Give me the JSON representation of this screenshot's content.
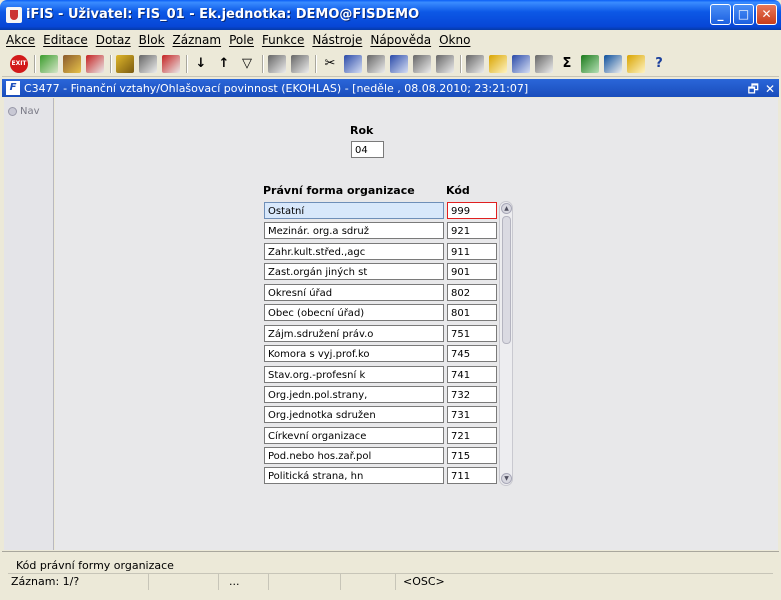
{
  "window": {
    "title": "iFIS - Uživatel: FIS_01 - Ek.jednotka: DEMO@FISDEMO"
  },
  "menu": [
    "Akce",
    "Editace",
    "Dotaz",
    "Blok",
    "Záznam",
    "Pole",
    "Funkce",
    "Nástroje",
    "Nápověda",
    "Okno"
  ],
  "toolbar": {
    "exit_label": "EXIT"
  },
  "form": {
    "title": "C3477 - Finanční vztahy/Ohlašovací povinnost (EKOHLAS) - [neděle , 08.08.2010; 23:21:07]",
    "nav_label": "Nav",
    "rok_label": "Rok",
    "rok_value": "04",
    "col_name_header": "Právní forma organizace",
    "col_code_header": "Kód",
    "rows": [
      {
        "name": "Ostatní",
        "code": "999"
      },
      {
        "name": "Mezinár. org.a sdruž",
        "code": "921"
      },
      {
        "name": "Zahr.kult.střed.,agc",
        "code": "911"
      },
      {
        "name": "Zast.orgán jiných st",
        "code": "901"
      },
      {
        "name": "Okresní úřad",
        "code": "802"
      },
      {
        "name": "Obec (obecní úřad)",
        "code": "801"
      },
      {
        "name": "Zájm.sdružení práv.o",
        "code": "751"
      },
      {
        "name": "Komora s vyj.prof.ko",
        "code": "745"
      },
      {
        "name": "Stav.org.-profesní k",
        "code": "741"
      },
      {
        "name": "Org.jedn.pol.strany,",
        "code": "732"
      },
      {
        "name": "Org.jednotka sdružen",
        "code": "731"
      },
      {
        "name": "Církevní organizace",
        "code": "721"
      },
      {
        "name": "Pod.nebo hos.zař.pol",
        "code": "715"
      },
      {
        "name": "Politická strana, hn",
        "code": "711"
      }
    ]
  },
  "status": {
    "message": "Kód právní formy organizace",
    "record": "Záznam: 1/?",
    "ellipsis": "...",
    "osc": "<OSC>"
  }
}
